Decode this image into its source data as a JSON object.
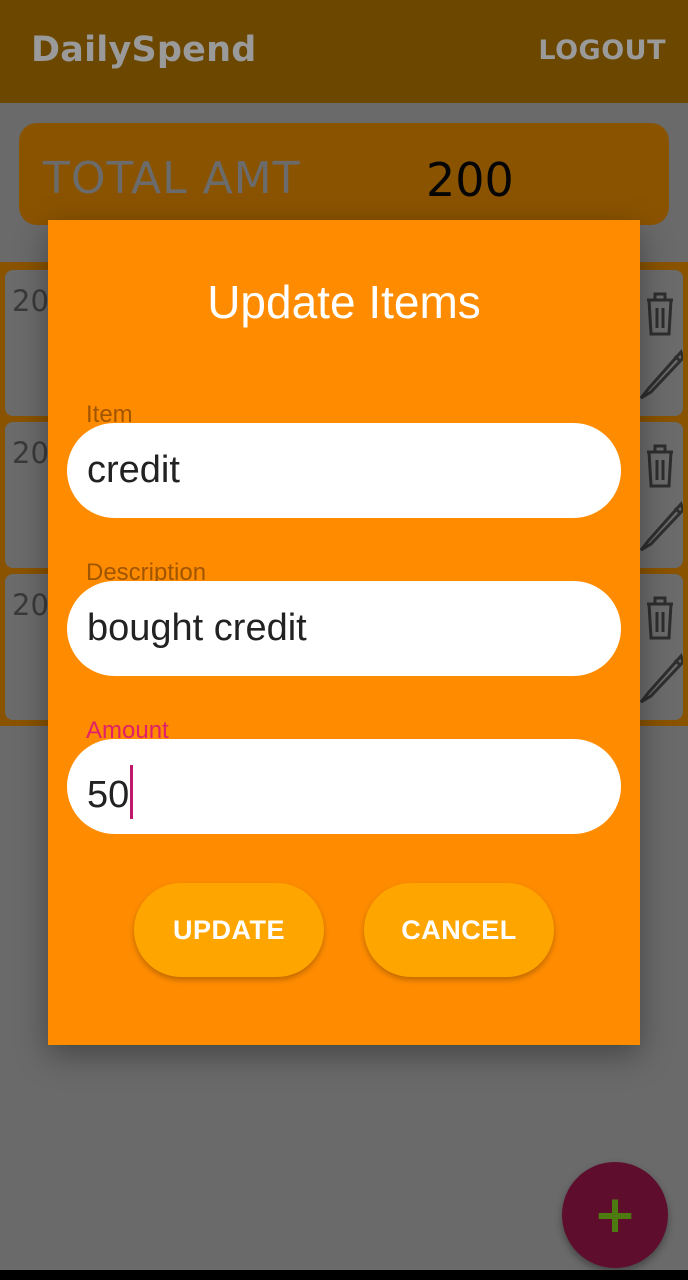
{
  "app": {
    "title": "DailySpend",
    "logout_label": "LOGOUT"
  },
  "summary": {
    "total_label": "TOTAL AMT",
    "total_value": "200"
  },
  "list": {
    "items": [
      {
        "date_prefix": "20",
        "delete_icon": "trash-icon",
        "edit_icon": "pencil-icon"
      },
      {
        "date_prefix": "20",
        "delete_icon": "trash-icon",
        "edit_icon": "pencil-icon"
      },
      {
        "date_prefix": "20",
        "delete_icon": "trash-icon",
        "edit_icon": "pencil-icon"
      }
    ]
  },
  "fab": {
    "label": "+",
    "icon": "plus-icon"
  },
  "dialog": {
    "title": "Update Items",
    "fields": [
      {
        "label": "Item",
        "value": "credit"
      },
      {
        "label": "Description",
        "value": "bought credit"
      },
      {
        "label": "Amount",
        "value": "50"
      }
    ],
    "update_label": "UPDATE",
    "cancel_label": "CANCEL"
  },
  "colors": {
    "dialog_bg": "#ff8c00",
    "button_bg": "#ffa500",
    "active_label": "#e0206a",
    "fab_bg": "#5e0e2c"
  }
}
